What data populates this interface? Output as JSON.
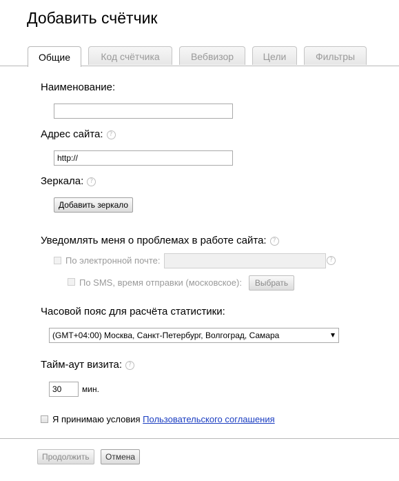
{
  "page": {
    "title": "Добавить счётчик"
  },
  "tabs": [
    {
      "label": "Общие"
    },
    {
      "label": "Код счётчика"
    },
    {
      "label": "Вебвизор"
    },
    {
      "label": "Цели"
    },
    {
      "label": "Фильтры"
    }
  ],
  "form": {
    "name_label": "Наименование:",
    "name_value": "",
    "site_label": "Адрес сайта:",
    "site_value": "http://",
    "mirrors_label": "Зеркала:",
    "add_mirror_button": "Добавить зеркало",
    "notify_label": "Уведомлять меня о проблемах в работе сайта:",
    "email_label": "По электронной почте:",
    "email_value": "",
    "sms_label": "По SMS, время отправки (московское):",
    "choose_button": "Выбрать",
    "timezone_label": "Часовой пояс для расчёта статистики:",
    "timezone_value": "(GMT+04:00) Москва, Санкт-Петербург, Волгоград, Самара",
    "timeout_label": "Тайм-аут визита:",
    "timeout_value": "30",
    "timeout_unit": "мин.",
    "terms_text": "Я принимаю условия",
    "terms_link": "Пользовательского соглашения"
  },
  "help_icon_glyph": "?",
  "footer": {
    "continue_button": "Продолжить",
    "cancel_button": "Отмена"
  },
  "colors": {
    "link": "#1a3dc1",
    "disabled_text": "#9a9a9a",
    "border": "#a9a9a9"
  }
}
